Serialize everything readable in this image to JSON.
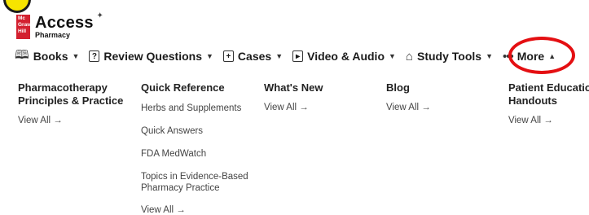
{
  "logo": {
    "box_lines": [
      "Mc",
      "Graw",
      "Hill"
    ],
    "title": "Access",
    "subtitle": "Pharmacy"
  },
  "nav": {
    "items": [
      {
        "label": "Books",
        "icon": "book-icon"
      },
      {
        "label": "Review Questions",
        "icon": "question-box-icon"
      },
      {
        "label": "Cases",
        "icon": "clipboard-plus-icon"
      },
      {
        "label": "Video & Audio",
        "icon": "play-box-icon"
      },
      {
        "label": "Study Tools",
        "icon": "graduation-cap-icon"
      }
    ],
    "more_label": "More"
  },
  "columns": [
    {
      "heading_line1": "Pharmacotherapy",
      "heading_line2": "Principles & Practice",
      "view_all": "View All"
    },
    {
      "heading": "Quick Reference",
      "links": [
        "Herbs and Supplements",
        "Quick Answers",
        "FDA MedWatch",
        "Topics in Evidence-Based Pharmacy Practice"
      ],
      "view_all": "View All"
    },
    {
      "heading": "What's New",
      "view_all": "View All"
    },
    {
      "heading": "Blog",
      "view_all": "View All"
    },
    {
      "heading_line1": "Patient Educatio",
      "heading_line2": "Handouts",
      "view_all": "View All"
    }
  ],
  "arrow": "→",
  "colors": {
    "brand_red": "#d3202f",
    "highlight_ring": "#e40f12",
    "highlight_dot": "#f6e400"
  }
}
